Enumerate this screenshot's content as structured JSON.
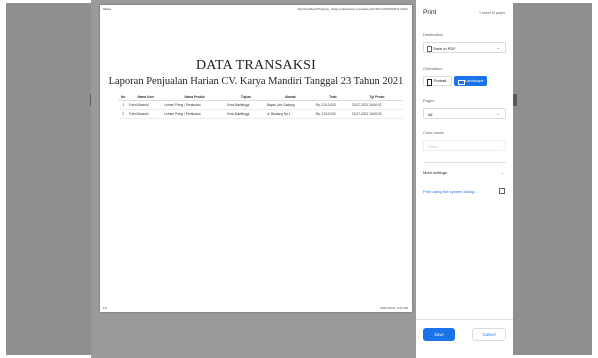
{
  "preview": {
    "header_left": "Slides",
    "header_right": "http://localhost/Program_Stieje-Indeks/web_transaksi.php?ID=CHSSFN1871=2021",
    "footer_left": "1/1",
    "footer_right": "23/07/2021, 9:47 AM",
    "title": "DATA TRANSAKSI",
    "subtitle": "Laporan Penjualan Harian CV. Karya Mandiri Tanggal 23 Tahun 2021",
    "table": {
      "headers": [
        "No",
        "Nama User",
        "Nama Produk",
        "Tujuan",
        "Alamat",
        "Total",
        "Tgl Pesan"
      ],
      "rows": [
        [
          "1",
          "Fahri Marzuki",
          "Lemari Piring / Perabotan",
          "Kota Bukittinggi",
          "Bayan Jorr Gadang",
          "Rp. 2.512.000",
          "23-07-2021 16:50:02"
        ],
        [
          "2",
          "Fahri Marzuki",
          "Lemari Piring / Perabotan",
          "Kota Bukittinggi",
          "Jr. Bantang No.1",
          "Rp. 2.512.000",
          "23-07-2021 16:50:02"
        ]
      ]
    }
  },
  "dialog": {
    "title": "Print",
    "sheets": "1 sheet of paper",
    "destination_label": "Destination",
    "destination_value": "Save to PDF",
    "orientation_label": "Orientation",
    "portrait_label": "Portrait",
    "landscape_label": "Landscape",
    "pages_label": "Pages",
    "pages_value": "All",
    "color_label": "Color mode",
    "color_value": "Color",
    "more_settings": "More settings",
    "system_dialog": "Print using the system dialog...",
    "save_label": "Save",
    "cancel_label": "Cancel",
    "accent_color": "#1a73e8"
  }
}
